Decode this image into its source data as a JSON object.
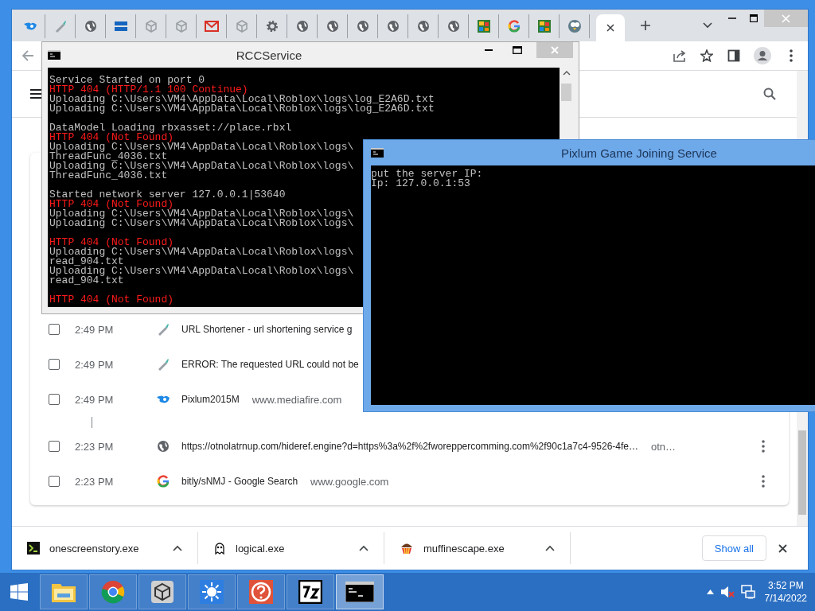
{
  "browser": {
    "tabs": [
      {
        "kind": "mediafire",
        "selected": false
      },
      {
        "kind": "pen",
        "selected": false
      },
      {
        "kind": "globe",
        "selected": false
      },
      {
        "kind": "bigfish",
        "selected": false
      },
      {
        "kind": "unity",
        "selected": false
      },
      {
        "kind": "unity",
        "selected": false
      },
      {
        "kind": "mail",
        "selected": false
      },
      {
        "kind": "unity",
        "selected": false
      },
      {
        "kind": "gear",
        "selected": false
      },
      {
        "kind": "globe",
        "selected": false
      },
      {
        "kind": "globe",
        "selected": false
      },
      {
        "kind": "globe",
        "selected": false
      },
      {
        "kind": "globe",
        "selected": false
      },
      {
        "kind": "globe",
        "selected": false
      },
      {
        "kind": "globe",
        "selected": false
      },
      {
        "kind": "game",
        "selected": false
      },
      {
        "kind": "google",
        "selected": false
      },
      {
        "kind": "game",
        "selected": false
      },
      {
        "kind": "bird",
        "selected": false
      },
      {
        "kind": "page",
        "selected": true
      }
    ],
    "history": {
      "groups": [
        {
          "rows": [
            {
              "checked": false,
              "time": "2:49 PM",
              "kind": "pen",
              "title": "URL Shortener - url shortening service g"
            },
            {
              "checked": false,
              "time": "2:49 PM",
              "kind": "pen",
              "title": "ERROR: The requested URL could not be"
            },
            {
              "checked": false,
              "time": "2:49 PM",
              "kind": "mediafire",
              "title": "Pixlum2015M",
              "domain": "www.mediafire.com"
            }
          ]
        },
        {
          "rows": [
            {
              "checked": false,
              "time": "2:23 PM",
              "kind": "globe",
              "title": "https://otnolatrnup.com/hideref.engine?d=https%3a%2f%2fworeppercomming.com%2f90c1a7c4-9526-4fe…",
              "domain": "otn…",
              "more_button": true
            },
            {
              "checked": false,
              "time": "2:23 PM",
              "kind": "google",
              "title": "bitly/sNMJ - Google Search",
              "domain": "www.google.com",
              "more_button": true
            }
          ]
        }
      ]
    },
    "downloads": {
      "items": [
        {
          "kind": "terminal",
          "name": "onescreenstory.exe"
        },
        {
          "kind": "ghost",
          "name": "logical.exe"
        },
        {
          "kind": "muffin",
          "name": "muffinescape.exe"
        }
      ],
      "show_all": "Show all"
    }
  },
  "rcc_window": {
    "title": "RCCService",
    "blocks": [
      [
        {
          "kind": "info",
          "text": "Service Started on port 0"
        },
        {
          "kind": "error",
          "text": "HTTP 404 (HTTP/1.1 100 Continue)"
        },
        {
          "kind": "info",
          "text": "Uploading C:\\Users\\VM4\\AppData\\Local\\Roblox\\logs\\log_E2A6D.txt"
        },
        {
          "kind": "info",
          "text": "Uploading C:\\Users\\VM4\\AppData\\Local\\Roblox\\logs\\log_E2A6D.txt"
        }
      ],
      [
        {
          "kind": "info",
          "text": "DataModel Loading rbxasset://place.rbxl"
        },
        {
          "kind": "error",
          "text": "HTTP 404 (Not Found)"
        },
        {
          "kind": "info",
          "text": "Uploading C:\\Users\\VM4\\AppData\\Local\\Roblox\\logs\\"
        },
        {
          "kind": "info",
          "text": "ThreadFunc_4036.txt"
        },
        {
          "kind": "info",
          "text": "Uploading C:\\Users\\VM4\\AppData\\Local\\Roblox\\logs\\"
        },
        {
          "kind": "info",
          "text": "ThreadFunc_4036.txt"
        }
      ],
      [
        {
          "kind": "info",
          "text": "Started network server 127.0.0.1|53640"
        },
        {
          "kind": "error",
          "text": "HTTP 404 (Not Found)"
        },
        {
          "kind": "info",
          "text": "Uploading C:\\Users\\VM4\\AppData\\Local\\Roblox\\logs\\"
        },
        {
          "kind": "info",
          "text": "Uploading C:\\Users\\VM4\\AppData\\Local\\Roblox\\logs\\"
        }
      ],
      [
        {
          "kind": "error",
          "text": "HTTP 404 (Not Found)"
        },
        {
          "kind": "info",
          "text": "Uploading C:\\Users\\VM4\\AppData\\Local\\Roblox\\logs\\"
        },
        {
          "kind": "info",
          "text": "read_904.txt"
        },
        {
          "kind": "info",
          "text": "Uploading C:\\Users\\VM4\\AppData\\Local\\Roblox\\logs\\"
        },
        {
          "kind": "info",
          "text": "read_904.txt"
        }
      ],
      [
        {
          "kind": "error",
          "text": "HTTP 404 (Not Found)"
        }
      ]
    ]
  },
  "join_window": {
    "title": "Pixlum Game Joining Service",
    "lines": [
      "put the server IP:",
      "Ip: 127.0.0.1:53"
    ]
  },
  "taskbar": {
    "apps": [
      {
        "kind": "folder",
        "selected": false
      },
      {
        "kind": "chrome",
        "selected": false
      },
      {
        "kind": "unity",
        "selected": false
      },
      {
        "kind": "sun",
        "selected": false
      },
      {
        "kind": "help",
        "selected": false
      },
      {
        "kind": "archive",
        "selected": false
      },
      {
        "kind": "console",
        "selected": true
      }
    ],
    "time": "3:52 PM",
    "date": "7/14/2022"
  }
}
